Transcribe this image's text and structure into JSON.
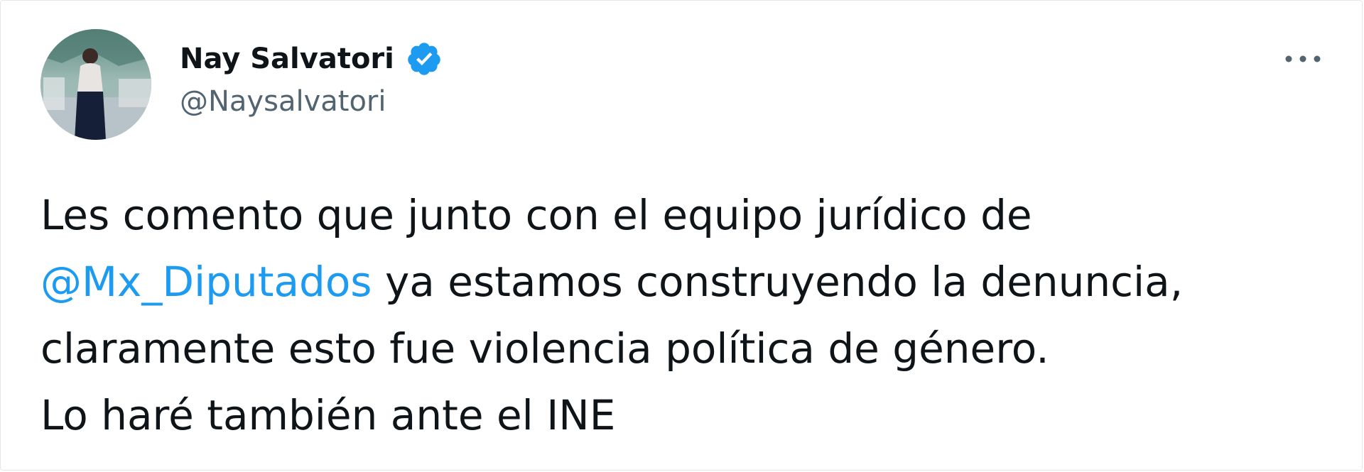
{
  "tweet": {
    "author": {
      "display_name": "Nay Salvatori",
      "handle": "@Naysalvatori",
      "verified": true,
      "avatar_icon": "profile-photo"
    },
    "menu_icon": "more-options-icon",
    "text": {
      "line1": "Les comento que junto con el equipo jurídico de",
      "line2_mention": "@Mx_Diputados",
      "line2_rest": " ya estamos construyendo la denuncia,",
      "line3": "claramente esto fue violencia política de género.",
      "line4": "Lo haré también ante el INE"
    },
    "colors": {
      "mention": "#1d9bf0",
      "verified_badge": "#1d9bf0",
      "handle": "#536471",
      "text": "#0f1419"
    }
  }
}
